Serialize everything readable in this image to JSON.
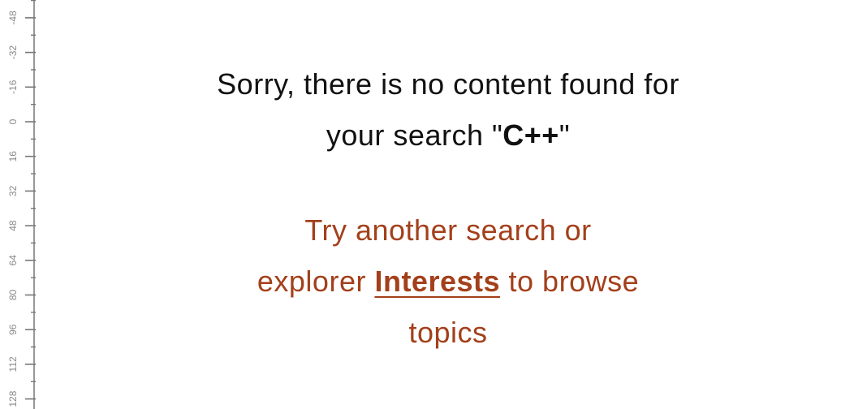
{
  "ruler": {
    "labels": [
      "-48",
      "-32",
      "-16",
      "0",
      "16",
      "32",
      "48",
      "64",
      "80",
      "96",
      "112",
      "128"
    ]
  },
  "message": {
    "line1": "Sorry, there is no content found for",
    "line2_prefix": "your search \"",
    "query": "C++",
    "line2_suffix": "\""
  },
  "suggestion": {
    "line1": "Try another search or",
    "prefix": "explorer ",
    "link": "Interests",
    "suffix": " to browse",
    "line3": "topics"
  },
  "colors": {
    "accent": "#a3401b",
    "ruler": "#777777"
  }
}
